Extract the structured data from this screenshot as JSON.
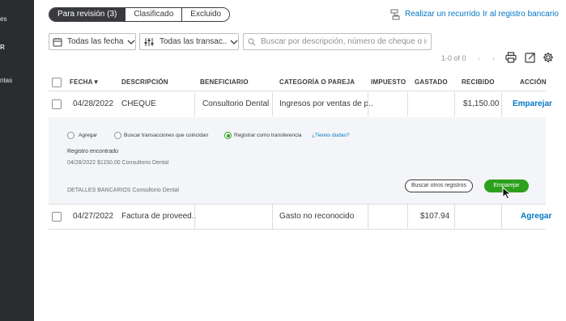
{
  "sidebar": {
    "items": [
      {
        "label": "es",
        "bold": false
      },
      {
        "label": "R",
        "bold": true
      },
      {
        "label": "ntas",
        "bold": false
      }
    ]
  },
  "tabs": [
    {
      "label": "Para revisión (3)",
      "active": true
    },
    {
      "label": "Clasificado",
      "active": false
    },
    {
      "label": "Excluido",
      "active": false
    }
  ],
  "links": {
    "recurring": "Realizar un recurrido",
    "register": "Ir al registro bancario"
  },
  "filters": {
    "date": "Todas las fechas",
    "transactions": "Todas las transac..."
  },
  "search": {
    "placeholder": "Buscar por descripción, número de cheque o imp..."
  },
  "pager": {
    "text": "1-0 of 0",
    "prev": "‹",
    "next": "›"
  },
  "icons": {
    "print": "printer-icon",
    "export": "export-icon",
    "settings": "gear-icon",
    "calendar": "calendar-icon",
    "filter": "sliders-icon",
    "search": "search-icon"
  },
  "table": {
    "headers": {
      "date": "FECHA",
      "description": "DESCRIPCIÓN",
      "payee": "BENEFICIARIO",
      "category": "CATEGORÍA O PAREJA",
      "tax": "IMPUESTO",
      "spent": "GASTADO",
      "received": "RECIBIDO",
      "action": "ACCIÓN"
    },
    "rows": [
      {
        "date": "04/28/2022",
        "description": "CHEQUE",
        "payee": "Consultorio Dental",
        "category": "Ingresos por ventas de p..",
        "tax": "",
        "spent": "",
        "received": "$1,150.00",
        "action": "Emparejar"
      },
      {
        "date": "04/27/2022",
        "description": "Factura de proveed..",
        "payee": "",
        "category": "Gasto no reconocido",
        "tax": "",
        "spent": "$107.94",
        "received": "",
        "action": "Agregar"
      }
    ]
  },
  "panel": {
    "options": [
      {
        "label": "Agregar",
        "checked": false
      },
      {
        "label": "Buscar transacciones que coincidan",
        "checked": false
      },
      {
        "label": "Registrar como transferencia",
        "checked": true
      }
    ],
    "help": "¿Tienes dudas?",
    "found_title": "Registro encontrado",
    "found_detail": "04/28/2022 $1150.00 Consultorio Dental",
    "bank_details": "DETALLES BANCARIOS Consultorio Dental",
    "btn_search": "Buscar otros registros",
    "btn_match": "Emparejar"
  },
  "colors": {
    "accent_blue": "#0077c5",
    "accent_green": "#2ca01c",
    "sidebar_bg": "#2b2c2e"
  }
}
